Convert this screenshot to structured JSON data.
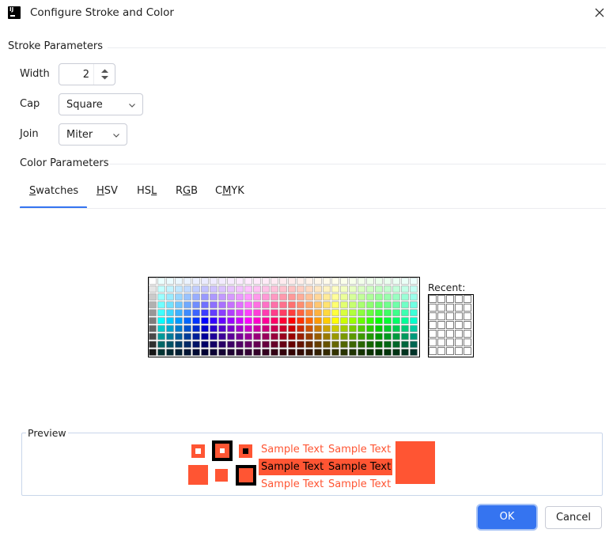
{
  "window": {
    "title": "Configure Stroke and Color"
  },
  "stroke": {
    "section_label": "Stroke Parameters",
    "width_label": "Width",
    "width_value": "2",
    "cap_label": "Cap",
    "cap_value": "Square",
    "join_label": "Join",
    "join_value": "Miter"
  },
  "color": {
    "section_label": "Color Parameters",
    "tabs": [
      {
        "pre": "",
        "u": "S",
        "post": "watches",
        "active": true
      },
      {
        "pre": "",
        "u": "H",
        "post": "SV",
        "active": false
      },
      {
        "pre": "HS",
        "u": "L",
        "post": "",
        "active": false
      },
      {
        "pre": "R",
        "u": "G",
        "post": "B",
        "active": false
      },
      {
        "pre": "C",
        "u": "M",
        "post": "YK",
        "active": false
      }
    ],
    "recent_label": "Recent:"
  },
  "preview": {
    "label": "Preview",
    "sample_text": "Sample Text",
    "color": "#ff5533"
  },
  "buttons": {
    "ok": "OK",
    "cancel": "Cancel"
  },
  "colors": {
    "accent": "#3574f0",
    "preview": "#ff5533"
  }
}
